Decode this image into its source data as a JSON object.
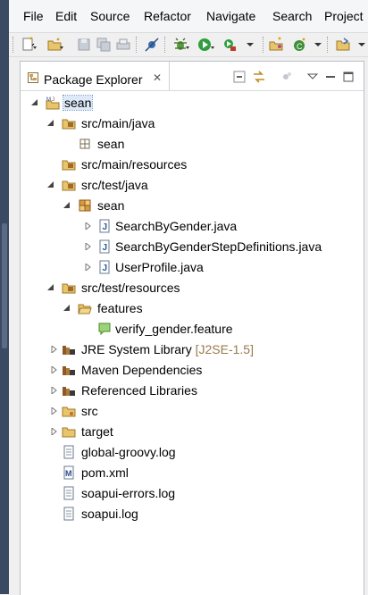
{
  "menubar": {
    "items": [
      {
        "label": "File"
      },
      {
        "label": "Edit"
      },
      {
        "label": "Source"
      },
      {
        "label": "Refactor"
      },
      {
        "label": "Navigate"
      },
      {
        "label": "Search"
      },
      {
        "label": "Project"
      }
    ]
  },
  "toolbar": {
    "icons": [
      "new-icon",
      "new-project-icon",
      "save-icon",
      "save-all-icon",
      "print-icon",
      "skip-breakpoints-icon",
      "debug-icon",
      "run-icon",
      "external-tools-icon",
      "new-java-project-icon",
      "new-class-icon",
      "open-type-icon"
    ]
  },
  "view": {
    "title": "Package Explorer",
    "close_glyph": "✕"
  },
  "tree": [
    {
      "label": "sean",
      "icon": "maven-project-icon",
      "expanded": true
    },
    {
      "label": "src/main/java",
      "icon": "source-folder-icon",
      "expanded": true
    },
    {
      "label": "sean",
      "icon": "empty-package-icon"
    },
    {
      "label": "src/main/resources",
      "icon": "source-folder-icon"
    },
    {
      "label": "src/test/java",
      "icon": "source-folder-icon",
      "expanded": true
    },
    {
      "label": "sean",
      "icon": "package-icon",
      "expanded": true
    },
    {
      "label": "SearchByGender.java",
      "icon": "java-file-icon",
      "collapsed": true
    },
    {
      "label": "SearchByGenderStepDefinitions.java",
      "icon": "java-file-icon",
      "collapsed": true
    },
    {
      "label": "UserProfile.java",
      "icon": "java-file-icon",
      "collapsed": true
    },
    {
      "label": "src/test/resources",
      "icon": "source-folder-icon",
      "expanded": true
    },
    {
      "label": "features",
      "icon": "folder-open-icon",
      "expanded": true
    },
    {
      "label": "verify_gender.feature",
      "icon": "feature-file-icon"
    },
    {
      "label": "JRE System Library",
      "decoration": "[J2SE-1.5]",
      "icon": "library-icon",
      "collapsed": true
    },
    {
      "label": "Maven Dependencies",
      "icon": "library-icon",
      "collapsed": true
    },
    {
      "label": "Referenced Libraries",
      "icon": "library-icon",
      "collapsed": true
    },
    {
      "label": "src",
      "icon": "folder-icon",
      "collapsed": true
    },
    {
      "label": "target",
      "icon": "folder-icon",
      "collapsed": true
    },
    {
      "label": "global-groovy.log",
      "icon": "text-file-icon"
    },
    {
      "label": "pom.xml",
      "icon": "maven-pom-icon"
    },
    {
      "label": "soapui-errors.log",
      "icon": "text-file-icon"
    },
    {
      "label": "soapui.log",
      "icon": "text-file-icon"
    }
  ]
}
